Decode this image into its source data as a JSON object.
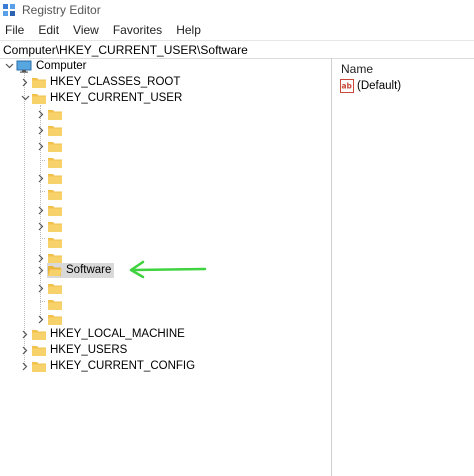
{
  "window": {
    "title": "Registry Editor",
    "icon": "registry-editor-icon"
  },
  "menu": [
    "File",
    "Edit",
    "View",
    "Favorites",
    "Help"
  ],
  "address": {
    "value": "Computer\\HKEY_CURRENT_USER\\Software"
  },
  "tree": {
    "root": "Computer",
    "hives": {
      "classes_root": "HKEY_CLASSES_ROOT",
      "current_user": "HKEY_CURRENT_USER",
      "local_machine": "HKEY_LOCAL_MACHINE",
      "users": "HKEY_USERS",
      "current_config": "HKEY_CURRENT_CONFIG"
    },
    "selected_key": "Software"
  },
  "values_pane": {
    "column_name": "Name",
    "rows": [
      {
        "name": "(Default)",
        "type_icon": "reg-sz-ab-icon"
      }
    ]
  },
  "colors": {
    "accent_arrow": "#3fd33f",
    "folder": "#f2c14e",
    "selection": "#d9d9d9"
  }
}
